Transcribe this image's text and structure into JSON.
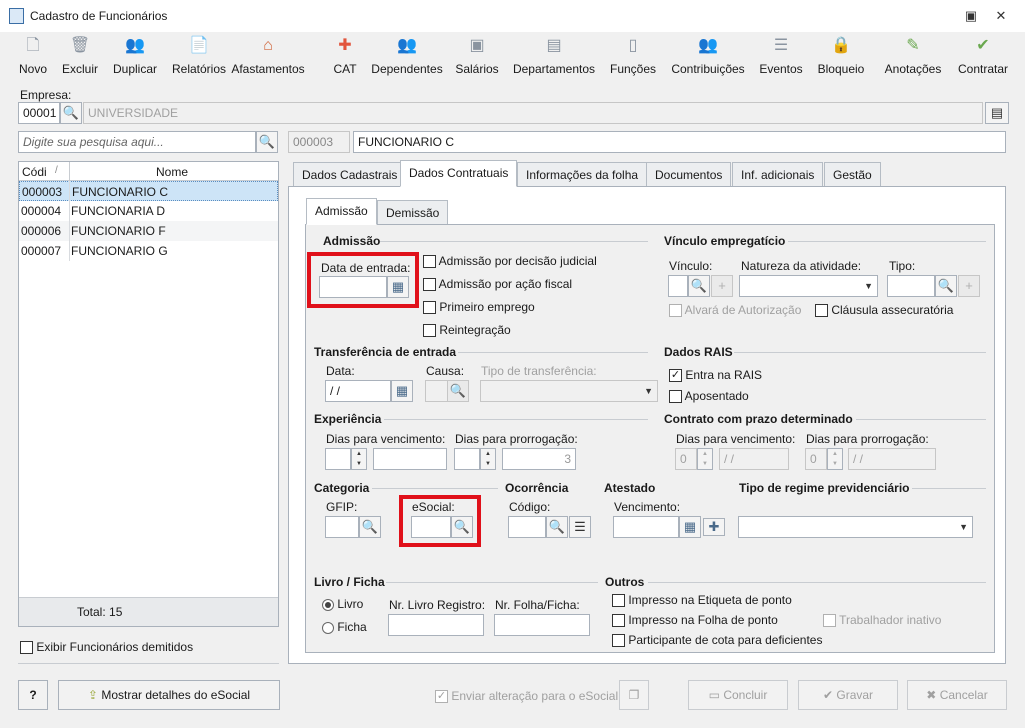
{
  "window": {
    "title": "Cadastro de Funcionários"
  },
  "toolbar": [
    {
      "label": "Novo",
      "icon": "new-document-icon",
      "glyph": "🗋"
    },
    {
      "label": "Excluir",
      "icon": "trash-icon",
      "glyph": "🗑"
    },
    {
      "label": "Duplicar",
      "icon": "users-icon",
      "glyph": "👥"
    },
    {
      "label": "Relatórios",
      "icon": "report-icon",
      "glyph": "📄"
    },
    {
      "label": "Afastamentos",
      "icon": "house-arrow-icon",
      "glyph": "⌂"
    },
    {
      "label": "CAT",
      "icon": "medical-cross-icon",
      "glyph": "✚"
    },
    {
      "label": "Dependentes",
      "icon": "dependents-icon",
      "glyph": "👥"
    },
    {
      "label": "Salários",
      "icon": "money-icon",
      "glyph": "▣"
    },
    {
      "label": "Departamentos",
      "icon": "desk-icon",
      "glyph": "▤"
    },
    {
      "label": "Funções",
      "icon": "badge-icon",
      "glyph": "▯"
    },
    {
      "label": "Contribuições",
      "icon": "contributions-icon",
      "glyph": "👥"
    },
    {
      "label": "Eventos",
      "icon": "events-list-icon",
      "glyph": "☰"
    },
    {
      "label": "Bloqueio",
      "icon": "lock-icon",
      "glyph": "🔒"
    },
    {
      "label": "Anotações",
      "icon": "notes-check-icon",
      "glyph": "✎"
    },
    {
      "label": "Contratar",
      "icon": "hire-check-icon",
      "glyph": "✔"
    }
  ],
  "empresa": {
    "label": "Empresa:",
    "code": "00001",
    "name": "UNIVERSIDADE"
  },
  "search": {
    "placeholder": "Digite sua pesquisa aqui..."
  },
  "employee": {
    "code": "000003",
    "name": "FUNCIONARIO C"
  },
  "list": {
    "headers": {
      "code": "Códi",
      "name": "Nome"
    },
    "rows": [
      {
        "code": "000003",
        "name": "FUNCIONARIO C"
      },
      {
        "code": "000004",
        "name": "FUNCIONARIA D"
      },
      {
        "code": "000006",
        "name": "FUNCIONARIO F"
      },
      {
        "code": "000007",
        "name": "FUNCIONARIO G"
      }
    ],
    "total": "Total: 15"
  },
  "show_dismissed": "Exibir Funcionários demitidos",
  "tabs": [
    "Dados Cadastrais",
    "Dados Contratuais",
    "Informações da folha",
    "Documentos",
    "Inf. adicionais",
    "Gestão"
  ],
  "subtabs": [
    "Admissão",
    "Demissão"
  ],
  "admissao": {
    "title": "Admissão",
    "data_entrada": "Data de entrada:",
    "checks": [
      "Admissão por decisão judicial",
      "Admissão por ação fiscal",
      "Primeiro emprego",
      "Reintegração"
    ]
  },
  "vinculo": {
    "title": "Vínculo empregatício",
    "vinculo": "Vínculo:",
    "natureza": "Natureza da atividade:",
    "tipo": "Tipo:",
    "alvara": "Alvará de Autorização",
    "clausula": "Cláusula assecuratória"
  },
  "transferencia": {
    "title": "Transferência de entrada",
    "data": "Data:",
    "data_value": " / /",
    "causa": "Causa:",
    "tipo": "Tipo de transferência:"
  },
  "rais": {
    "title": "Dados RAIS",
    "entra": "Entra na RAIS",
    "aposentado": "Aposentado"
  },
  "experiencia": {
    "title": "Experiência",
    "dias_venc": "Dias para vencimento:",
    "dias_prorr": "Dias para prorrogação:",
    "prorr_value": "3"
  },
  "contrato": {
    "title": "Contrato com prazo determinado",
    "dias_venc": "Dias para vencimento:",
    "dias_prorr": "Dias para prorrogação:",
    "zero": "0",
    "date": " / /"
  },
  "categoria": {
    "title": "Categoria",
    "gfip": "GFIP:",
    "esocial": "eSocial:"
  },
  "ocorrencia": {
    "title": "Ocorrência",
    "codigo": "Código:"
  },
  "atestado": {
    "title": "Atestado",
    "vencimento": "Vencimento:"
  },
  "regime": {
    "title": "Tipo de regime previdenciário"
  },
  "livro": {
    "title": "Livro / Ficha",
    "livro": "Livro",
    "ficha": "Ficha",
    "nr_livro": "Nr. Livro Registro:",
    "nr_folha": "Nr. Folha/Ficha:"
  },
  "outros": {
    "title": "Outros",
    "etiqueta": "Impresso na Etiqueta de ponto",
    "folha": "Impresso na Folha de ponto",
    "inativo": "Trabalhador inativo",
    "cota": "Participante de cota para deficientes"
  },
  "footer": {
    "help": "?",
    "esocial_details": "Mostrar detalhes do eSocial",
    "enviar": "Enviar alteração para o eSocial",
    "concluir": "Concluir",
    "gravar": "Gravar",
    "cancelar": "Cancelar"
  }
}
